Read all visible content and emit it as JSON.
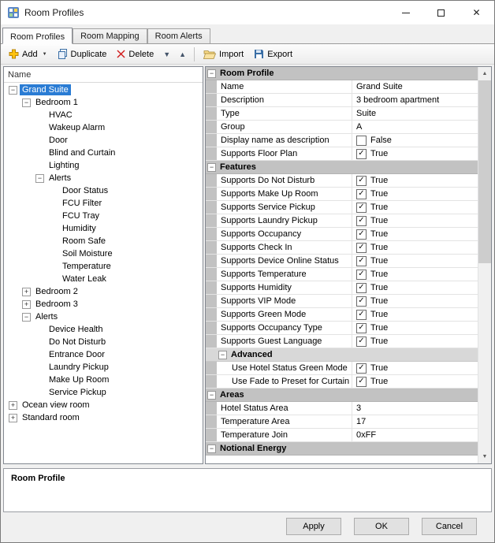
{
  "window": {
    "title": "Room Profiles"
  },
  "tabs": [
    {
      "label": "Room Profiles",
      "active": true
    },
    {
      "label": "Room Mapping",
      "active": false
    },
    {
      "label": "Room Alerts",
      "active": false
    }
  ],
  "toolbar": {
    "add_label": "Add",
    "duplicate_label": "Duplicate",
    "delete_label": "Delete",
    "import_label": "Import",
    "export_label": "Export"
  },
  "icons": {
    "close": "✕",
    "dropdown": "▼",
    "up_arrow": "▲",
    "down_arrow": "▼",
    "collapse": "−",
    "expand": "+",
    "check": "✓"
  },
  "colors": {
    "selection_blue": "#2a7cd4",
    "category_gray": "#c2c2c2",
    "advanced_gray": "#d8d8d8",
    "delete_red": "#d11c1c",
    "add_gold": "#ffc20e"
  },
  "tree": {
    "header": "Name",
    "items": [
      {
        "label": "Grand Suite",
        "depth": 0,
        "expand": "minus",
        "selected": true
      },
      {
        "label": "Bedroom 1",
        "depth": 1,
        "expand": "minus"
      },
      {
        "label": "HVAC",
        "depth": 2
      },
      {
        "label": "Wakeup Alarm",
        "depth": 2
      },
      {
        "label": "Door",
        "depth": 2
      },
      {
        "label": "Blind and Curtain",
        "depth": 2
      },
      {
        "label": "Lighting",
        "depth": 2
      },
      {
        "label": "Alerts",
        "depth": 2,
        "expand": "minus"
      },
      {
        "label": "Door Status",
        "depth": 3
      },
      {
        "label": "FCU Filter",
        "depth": 3
      },
      {
        "label": "FCU Tray",
        "depth": 3
      },
      {
        "label": "Humidity",
        "depth": 3
      },
      {
        "label": "Room Safe",
        "depth": 3
      },
      {
        "label": "Soil Moisture",
        "depth": 3
      },
      {
        "label": "Temperature",
        "depth": 3
      },
      {
        "label": "Water Leak",
        "depth": 3
      },
      {
        "label": "Bedroom 2",
        "depth": 1,
        "expand": "plus"
      },
      {
        "label": "Bedroom 3",
        "depth": 1,
        "expand": "plus"
      },
      {
        "label": "Alerts",
        "depth": 1,
        "expand": "minus"
      },
      {
        "label": "Device Health",
        "depth": 2
      },
      {
        "label": "Do Not Disturb",
        "depth": 2
      },
      {
        "label": "Entrance Door",
        "depth": 2
      },
      {
        "label": "Laundry Pickup",
        "depth": 2
      },
      {
        "label": "Make Up Room",
        "depth": 2
      },
      {
        "label": "Service Pickup",
        "depth": 2
      },
      {
        "label": "Ocean view room",
        "depth": 0,
        "expand": "plus"
      },
      {
        "label": "Standard room",
        "depth": 0,
        "expand": "plus"
      }
    ]
  },
  "property_grid": {
    "rows": [
      {
        "kind": "category",
        "label": "Room Profile"
      },
      {
        "kind": "text",
        "label": "Name",
        "value": "Grand Suite"
      },
      {
        "kind": "text",
        "label": "Description",
        "value": "3 bedroom apartment"
      },
      {
        "kind": "text",
        "label": "Type",
        "value": "Suite"
      },
      {
        "kind": "text",
        "label": "Group",
        "value": "A"
      },
      {
        "kind": "bool",
        "label": "Display name as description",
        "value": "False",
        "checked": false
      },
      {
        "kind": "bool",
        "label": "Supports Floor Plan",
        "value": "True",
        "checked": true
      },
      {
        "kind": "category",
        "label": "Features"
      },
      {
        "kind": "bool",
        "label": "Supports Do Not Disturb",
        "value": "True",
        "checked": true
      },
      {
        "kind": "bool",
        "label": "Supports Make Up Room",
        "value": "True",
        "checked": true
      },
      {
        "kind": "bool",
        "label": "Supports Service Pickup",
        "value": "True",
        "checked": true
      },
      {
        "kind": "bool",
        "label": "Supports Laundry Pickup",
        "value": "True",
        "checked": true
      },
      {
        "kind": "bool",
        "label": "Supports Occupancy",
        "value": "True",
        "checked": true
      },
      {
        "kind": "bool",
        "label": "Supports Check In",
        "value": "True",
        "checked": true
      },
      {
        "kind": "bool",
        "label": "Supports Device Online Status",
        "value": "True",
        "checked": true
      },
      {
        "kind": "bool",
        "label": "Supports Temperature",
        "value": "True",
        "checked": true
      },
      {
        "kind": "bool",
        "label": "Supports Humidity",
        "value": "True",
        "checked": true
      },
      {
        "kind": "bool",
        "label": "Supports VIP Mode",
        "value": "True",
        "checked": true
      },
      {
        "kind": "bool",
        "label": "Supports Green Mode",
        "value": "True",
        "checked": true
      },
      {
        "kind": "bool",
        "label": "Supports Occupancy Type",
        "value": "True",
        "checked": true
      },
      {
        "kind": "bool",
        "label": "Supports Guest Language",
        "value": "True",
        "checked": true
      },
      {
        "kind": "subcategory",
        "label": "Advanced"
      },
      {
        "kind": "bool",
        "label": "Use Hotel Status Green Mode",
        "value": "True",
        "checked": true,
        "indent": true
      },
      {
        "kind": "bool",
        "label": "Use Fade to Preset for Curtain",
        "value": "True",
        "checked": true,
        "indent": true
      },
      {
        "kind": "category",
        "label": "Areas"
      },
      {
        "kind": "text",
        "label": "Hotel Status Area",
        "value": "3"
      },
      {
        "kind": "text",
        "label": "Temperature Area",
        "value": "17"
      },
      {
        "kind": "text",
        "label": "Temperature Join",
        "value": "0xFF"
      },
      {
        "kind": "category",
        "label": "Notional Energy"
      }
    ]
  },
  "description": {
    "title": "Room Profile"
  },
  "footer": {
    "apply_label": "Apply",
    "ok_label": "OK",
    "cancel_label": "Cancel"
  }
}
